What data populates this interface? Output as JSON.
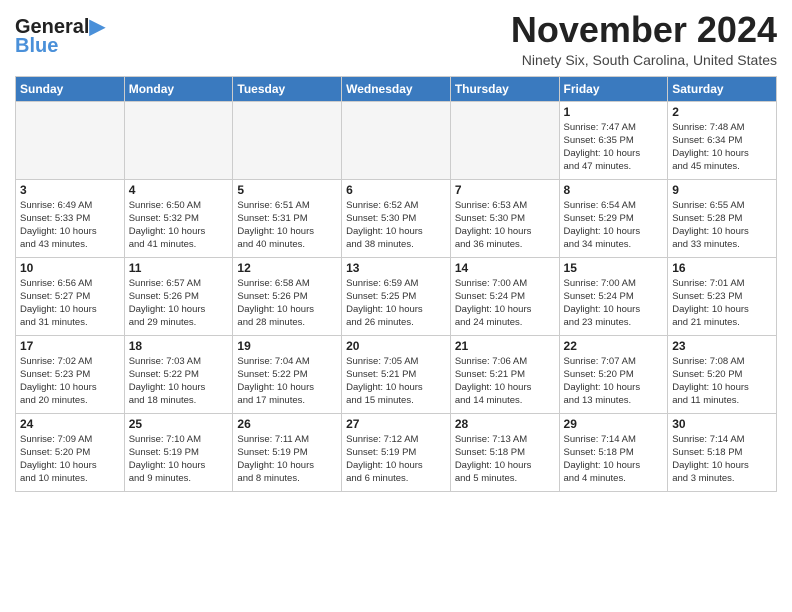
{
  "header": {
    "logo_line1": "General",
    "logo_line2": "Blue",
    "month_title": "November 2024",
    "location": "Ninety Six, South Carolina, United States"
  },
  "weekdays": [
    "Sunday",
    "Monday",
    "Tuesday",
    "Wednesday",
    "Thursday",
    "Friday",
    "Saturday"
  ],
  "weeks": [
    [
      {
        "day": "",
        "info": ""
      },
      {
        "day": "",
        "info": ""
      },
      {
        "day": "",
        "info": ""
      },
      {
        "day": "",
        "info": ""
      },
      {
        "day": "",
        "info": ""
      },
      {
        "day": "1",
        "info": "Sunrise: 7:47 AM\nSunset: 6:35 PM\nDaylight: 10 hours\nand 47 minutes."
      },
      {
        "day": "2",
        "info": "Sunrise: 7:48 AM\nSunset: 6:34 PM\nDaylight: 10 hours\nand 45 minutes."
      }
    ],
    [
      {
        "day": "3",
        "info": "Sunrise: 6:49 AM\nSunset: 5:33 PM\nDaylight: 10 hours\nand 43 minutes."
      },
      {
        "day": "4",
        "info": "Sunrise: 6:50 AM\nSunset: 5:32 PM\nDaylight: 10 hours\nand 41 minutes."
      },
      {
        "day": "5",
        "info": "Sunrise: 6:51 AM\nSunset: 5:31 PM\nDaylight: 10 hours\nand 40 minutes."
      },
      {
        "day": "6",
        "info": "Sunrise: 6:52 AM\nSunset: 5:30 PM\nDaylight: 10 hours\nand 38 minutes."
      },
      {
        "day": "7",
        "info": "Sunrise: 6:53 AM\nSunset: 5:30 PM\nDaylight: 10 hours\nand 36 minutes."
      },
      {
        "day": "8",
        "info": "Sunrise: 6:54 AM\nSunset: 5:29 PM\nDaylight: 10 hours\nand 34 minutes."
      },
      {
        "day": "9",
        "info": "Sunrise: 6:55 AM\nSunset: 5:28 PM\nDaylight: 10 hours\nand 33 minutes."
      }
    ],
    [
      {
        "day": "10",
        "info": "Sunrise: 6:56 AM\nSunset: 5:27 PM\nDaylight: 10 hours\nand 31 minutes."
      },
      {
        "day": "11",
        "info": "Sunrise: 6:57 AM\nSunset: 5:26 PM\nDaylight: 10 hours\nand 29 minutes."
      },
      {
        "day": "12",
        "info": "Sunrise: 6:58 AM\nSunset: 5:26 PM\nDaylight: 10 hours\nand 28 minutes."
      },
      {
        "day": "13",
        "info": "Sunrise: 6:59 AM\nSunset: 5:25 PM\nDaylight: 10 hours\nand 26 minutes."
      },
      {
        "day": "14",
        "info": "Sunrise: 7:00 AM\nSunset: 5:24 PM\nDaylight: 10 hours\nand 24 minutes."
      },
      {
        "day": "15",
        "info": "Sunrise: 7:00 AM\nSunset: 5:24 PM\nDaylight: 10 hours\nand 23 minutes."
      },
      {
        "day": "16",
        "info": "Sunrise: 7:01 AM\nSunset: 5:23 PM\nDaylight: 10 hours\nand 21 minutes."
      }
    ],
    [
      {
        "day": "17",
        "info": "Sunrise: 7:02 AM\nSunset: 5:23 PM\nDaylight: 10 hours\nand 20 minutes."
      },
      {
        "day": "18",
        "info": "Sunrise: 7:03 AM\nSunset: 5:22 PM\nDaylight: 10 hours\nand 18 minutes."
      },
      {
        "day": "19",
        "info": "Sunrise: 7:04 AM\nSunset: 5:22 PM\nDaylight: 10 hours\nand 17 minutes."
      },
      {
        "day": "20",
        "info": "Sunrise: 7:05 AM\nSunset: 5:21 PM\nDaylight: 10 hours\nand 15 minutes."
      },
      {
        "day": "21",
        "info": "Sunrise: 7:06 AM\nSunset: 5:21 PM\nDaylight: 10 hours\nand 14 minutes."
      },
      {
        "day": "22",
        "info": "Sunrise: 7:07 AM\nSunset: 5:20 PM\nDaylight: 10 hours\nand 13 minutes."
      },
      {
        "day": "23",
        "info": "Sunrise: 7:08 AM\nSunset: 5:20 PM\nDaylight: 10 hours\nand 11 minutes."
      }
    ],
    [
      {
        "day": "24",
        "info": "Sunrise: 7:09 AM\nSunset: 5:20 PM\nDaylight: 10 hours\nand 10 minutes."
      },
      {
        "day": "25",
        "info": "Sunrise: 7:10 AM\nSunset: 5:19 PM\nDaylight: 10 hours\nand 9 minutes."
      },
      {
        "day": "26",
        "info": "Sunrise: 7:11 AM\nSunset: 5:19 PM\nDaylight: 10 hours\nand 8 minutes."
      },
      {
        "day": "27",
        "info": "Sunrise: 7:12 AM\nSunset: 5:19 PM\nDaylight: 10 hours\nand 6 minutes."
      },
      {
        "day": "28",
        "info": "Sunrise: 7:13 AM\nSunset: 5:18 PM\nDaylight: 10 hours\nand 5 minutes."
      },
      {
        "day": "29",
        "info": "Sunrise: 7:14 AM\nSunset: 5:18 PM\nDaylight: 10 hours\nand 4 minutes."
      },
      {
        "day": "30",
        "info": "Sunrise: 7:14 AM\nSunset: 5:18 PM\nDaylight: 10 hours\nand 3 minutes."
      }
    ]
  ]
}
